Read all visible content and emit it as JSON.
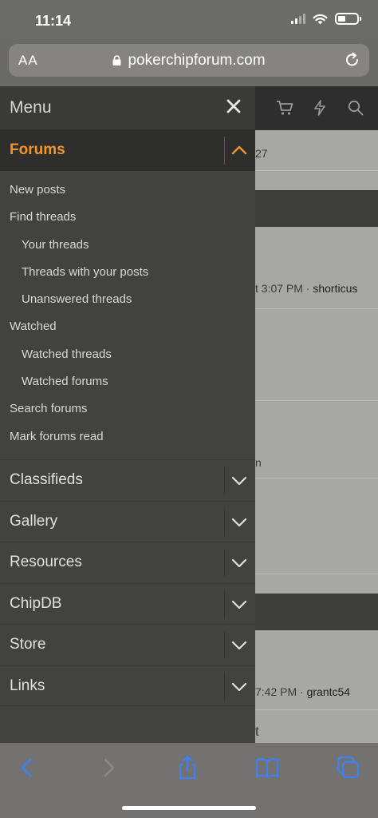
{
  "status_bar": {
    "time": "11:14"
  },
  "browser": {
    "text_size_label": "AA",
    "url": "pokerchipforum.com"
  },
  "background_page": {
    "rows": [
      {
        "text": "27"
      },
      {
        "text": "t 3:07 PM · ",
        "user": "shorticus"
      },
      {
        "text": "n"
      },
      {
        "text": "7:42 PM · ",
        "user": "grantc54"
      },
      {
        "text": "t"
      }
    ]
  },
  "menu": {
    "title": "Menu",
    "forums": {
      "label": "Forums",
      "links": [
        {
          "label": "New posts",
          "level": 1
        },
        {
          "label": "Find threads",
          "level": 1
        },
        {
          "label": "Your threads",
          "level": 2
        },
        {
          "label": "Threads with your posts",
          "level": 2
        },
        {
          "label": "Unanswered threads",
          "level": 2
        },
        {
          "label": "Watched",
          "level": 1
        },
        {
          "label": "Watched threads",
          "level": 2
        },
        {
          "label": "Watched forums",
          "level": 2
        },
        {
          "label": "Search forums",
          "level": 1
        },
        {
          "label": "Mark forums read",
          "level": 1
        }
      ]
    },
    "sections": [
      {
        "label": "Classifieds"
      },
      {
        "label": "Gallery"
      },
      {
        "label": "Resources"
      },
      {
        "label": "ChipDB"
      },
      {
        "label": "Store"
      },
      {
        "label": "Links"
      }
    ]
  },
  "colors": {
    "accent": "#f0962c",
    "ios_blue": "#3a82f7"
  }
}
